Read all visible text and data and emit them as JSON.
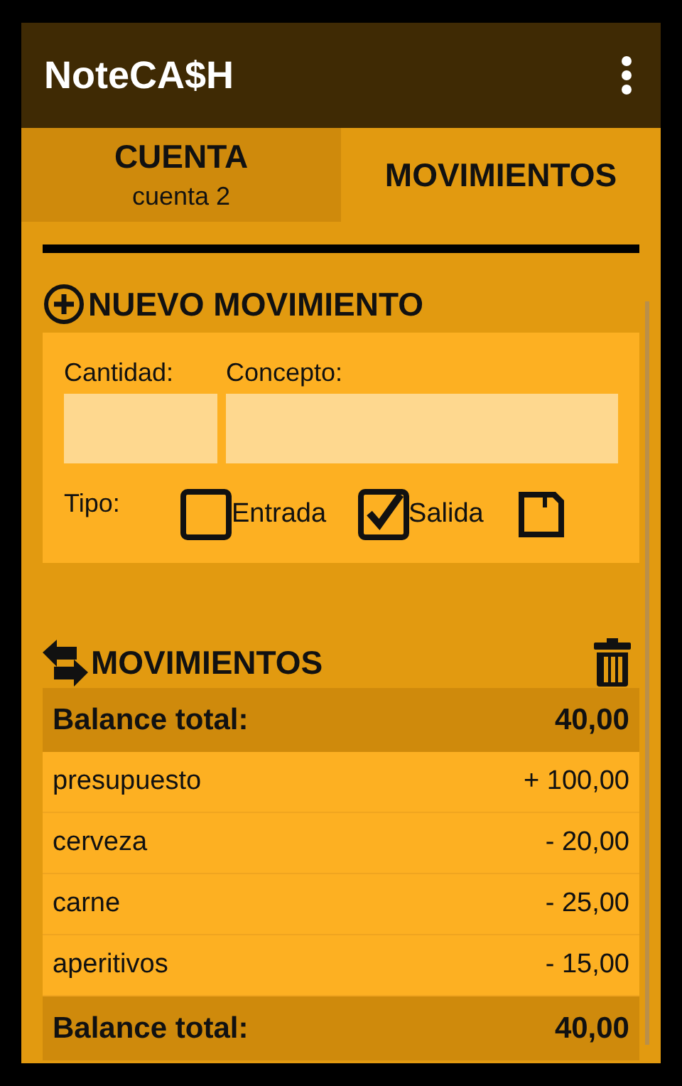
{
  "app_bar": {
    "title": "NoteCA$H"
  },
  "tabs": [
    {
      "label": "CUENTA",
      "subtitle": "cuenta 2",
      "selected": true
    },
    {
      "label": "MOVIMIENTOS",
      "selected": false
    }
  ],
  "new_movement": {
    "title": "NUEVO MOVIMIENTO",
    "amount_label": "Cantidad:",
    "concept_label": "Concepto:",
    "type_label": "Tipo:",
    "options": [
      {
        "label": "Entrada",
        "checked": false
      },
      {
        "label": "Salida",
        "checked": true
      }
    ]
  },
  "movements": {
    "title": "MOVIMIENTOS",
    "rows": [
      {
        "kind": "total",
        "concept": "Balance total:",
        "amount": "40,00"
      },
      {
        "kind": "item",
        "concept": "presupuesto",
        "amount": "+ 100,00"
      },
      {
        "kind": "item",
        "concept": "cerveza",
        "amount": "- 20,00"
      },
      {
        "kind": "item",
        "concept": "carne",
        "amount": "- 25,00"
      },
      {
        "kind": "item",
        "concept": "aperitivos",
        "amount": "- 15,00"
      },
      {
        "kind": "total",
        "concept": "Balance total:",
        "amount": "40,00"
      }
    ]
  }
}
